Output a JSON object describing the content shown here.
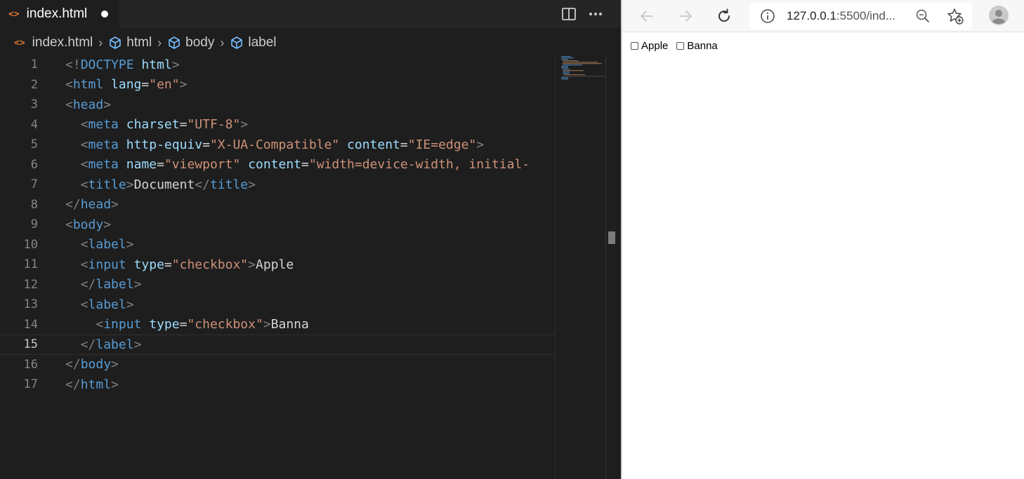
{
  "editor": {
    "tab": {
      "label": "index.html",
      "icon": "html-file-icon",
      "dirty": true
    },
    "actions": {
      "split": "split-editor-icon",
      "more": "more-actions-icon"
    },
    "breadcrumb": [
      {
        "label": "index.html",
        "icon": "html-file-icon"
      },
      {
        "label": "html",
        "icon": "element-cube-icon"
      },
      {
        "label": "body",
        "icon": "element-cube-icon"
      },
      {
        "label": "label",
        "icon": "element-cube-icon"
      }
    ],
    "current_line": 15,
    "lines": [
      {
        "n": "1",
        "tokens": [
          [
            "punc",
            "<!"
          ],
          [
            "tag",
            "DOCTYPE"
          ],
          [
            "text",
            " "
          ],
          [
            "attr",
            "html"
          ],
          [
            "punc",
            ">"
          ]
        ]
      },
      {
        "n": "2",
        "tokens": [
          [
            "punc",
            "<"
          ],
          [
            "tag",
            "html"
          ],
          [
            "text",
            " "
          ],
          [
            "attr",
            "lang"
          ],
          [
            "eq",
            "="
          ],
          [
            "str",
            "\"en\""
          ],
          [
            "punc",
            ">"
          ]
        ]
      },
      {
        "n": "3",
        "tokens": [
          [
            "punc",
            "<"
          ],
          [
            "tag",
            "head"
          ],
          [
            "punc",
            ">"
          ]
        ]
      },
      {
        "n": "4",
        "tokens": [
          [
            "text",
            "  "
          ],
          [
            "punc",
            "<"
          ],
          [
            "tag",
            "meta"
          ],
          [
            "text",
            " "
          ],
          [
            "attr",
            "charset"
          ],
          [
            "eq",
            "="
          ],
          [
            "str",
            "\"UTF-8\""
          ],
          [
            "punc",
            ">"
          ]
        ]
      },
      {
        "n": "5",
        "tokens": [
          [
            "text",
            "  "
          ],
          [
            "punc",
            "<"
          ],
          [
            "tag",
            "meta"
          ],
          [
            "text",
            " "
          ],
          [
            "attr",
            "http-equiv"
          ],
          [
            "eq",
            "="
          ],
          [
            "str",
            "\"X-UA-Compatible\""
          ],
          [
            "text",
            " "
          ],
          [
            "attr",
            "content"
          ],
          [
            "eq",
            "="
          ],
          [
            "str",
            "\"IE=edge\""
          ],
          [
            "punc",
            ">"
          ]
        ]
      },
      {
        "n": "6",
        "tokens": [
          [
            "text",
            "  "
          ],
          [
            "punc",
            "<"
          ],
          [
            "tag",
            "meta"
          ],
          [
            "text",
            " "
          ],
          [
            "attr",
            "name"
          ],
          [
            "eq",
            "="
          ],
          [
            "str",
            "\"viewport\""
          ],
          [
            "text",
            " "
          ],
          [
            "attr",
            "content"
          ],
          [
            "eq",
            "="
          ],
          [
            "str",
            "\"width=device-width, initial-"
          ]
        ]
      },
      {
        "n": "7",
        "tokens": [
          [
            "text",
            "  "
          ],
          [
            "punc",
            "<"
          ],
          [
            "tag",
            "title"
          ],
          [
            "punc",
            ">"
          ],
          [
            "text",
            "Document"
          ],
          [
            "punc",
            "</"
          ],
          [
            "tag",
            "title"
          ],
          [
            "punc",
            ">"
          ]
        ]
      },
      {
        "n": "8",
        "tokens": [
          [
            "punc",
            "</"
          ],
          [
            "tag",
            "head"
          ],
          [
            "punc",
            ">"
          ]
        ]
      },
      {
        "n": "9",
        "tokens": [
          [
            "punc",
            "<"
          ],
          [
            "tag",
            "body"
          ],
          [
            "punc",
            ">"
          ]
        ]
      },
      {
        "n": "10",
        "tokens": [
          [
            "text",
            "  "
          ],
          [
            "punc",
            "<"
          ],
          [
            "tag",
            "label"
          ],
          [
            "punc",
            ">"
          ]
        ]
      },
      {
        "n": "11",
        "tokens": [
          [
            "text",
            "  "
          ],
          [
            "punc",
            "<"
          ],
          [
            "tag",
            "input"
          ],
          [
            "text",
            " "
          ],
          [
            "attr",
            "type"
          ],
          [
            "eq",
            "="
          ],
          [
            "str",
            "\"checkbox\""
          ],
          [
            "punc",
            ">"
          ],
          [
            "text",
            "Apple"
          ]
        ]
      },
      {
        "n": "12",
        "tokens": [
          [
            "text",
            "  "
          ],
          [
            "punc",
            "</"
          ],
          [
            "tag",
            "label"
          ],
          [
            "punc",
            ">"
          ]
        ]
      },
      {
        "n": "13",
        "tokens": [
          [
            "text",
            "  "
          ],
          [
            "punc",
            "<"
          ],
          [
            "tag",
            "label"
          ],
          [
            "punc",
            ">"
          ]
        ]
      },
      {
        "n": "14",
        "tokens": [
          [
            "text",
            "    "
          ],
          [
            "punc",
            "<"
          ],
          [
            "tag",
            "input"
          ],
          [
            "text",
            " "
          ],
          [
            "attr",
            "type"
          ],
          [
            "eq",
            "="
          ],
          [
            "str",
            "\"checkbox\""
          ],
          [
            "punc",
            ">"
          ],
          [
            "text",
            "Banna"
          ]
        ]
      },
      {
        "n": "15",
        "tokens": [
          [
            "text",
            "  "
          ],
          [
            "punc",
            "</"
          ],
          [
            "tag",
            "label"
          ],
          [
            "punc",
            ">"
          ]
        ]
      },
      {
        "n": "16",
        "tokens": [
          [
            "punc",
            "</"
          ],
          [
            "tag",
            "body"
          ],
          [
            "punc",
            ">"
          ]
        ]
      },
      {
        "n": "17",
        "tokens": [
          [
            "punc",
            "</"
          ],
          [
            "tag",
            "html"
          ],
          [
            "punc",
            ">"
          ]
        ]
      }
    ]
  },
  "browser": {
    "back_icon": "back-arrow-icon",
    "forward_icon": "forward-arrow-icon",
    "reload_icon": "reload-icon",
    "address": {
      "info_icon": "site-info-icon",
      "host": "127.0.0.1",
      "rest": ":5500/ind..."
    },
    "zoom_icon": "zoom-out-icon",
    "favorite_icon": "add-favorite-icon",
    "profile_icon": "profile-avatar-icon",
    "page": {
      "checkboxes": [
        {
          "label": "Apple",
          "checked": false
        },
        {
          "label": "Banna",
          "checked": false
        }
      ]
    }
  },
  "colors": {
    "editor_bg": "#1e1e1e",
    "tag": "#569cd6",
    "attr": "#9cdcfe",
    "string": "#ce9178",
    "html_icon": "#e37933",
    "crumb_icon": "#75beff"
  }
}
